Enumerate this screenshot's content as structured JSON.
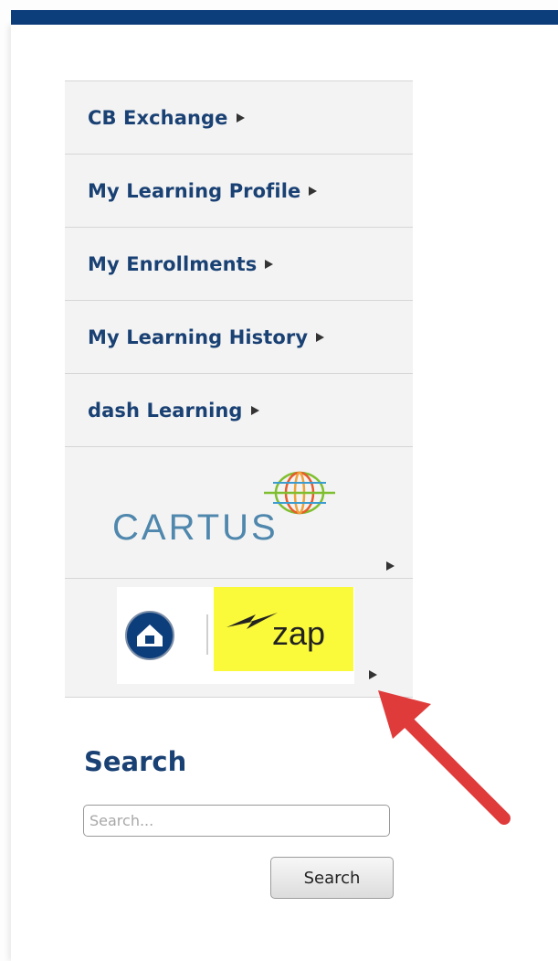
{
  "menu": {
    "items": [
      {
        "label": "CB Exchange"
      },
      {
        "label": "My Learning Profile"
      },
      {
        "label": "My Enrollments"
      },
      {
        "label": "My Learning History"
      },
      {
        "label": "dash Learning"
      }
    ],
    "cartus_logo": {
      "text": "CARTUS",
      "icon": "globe-icon"
    },
    "zap_logo": {
      "text": "zap",
      "icon": "house-badge-icon"
    }
  },
  "search": {
    "title": "Search",
    "placeholder": "Search...",
    "button_label": "Search"
  },
  "annotation": {
    "icon": "red-arrow-icon",
    "color": "#e03b3b"
  },
  "colors": {
    "brand_bar": "#0d3e7c",
    "menu_text": "#1a4174",
    "zap_yellow": "#faf93a"
  }
}
